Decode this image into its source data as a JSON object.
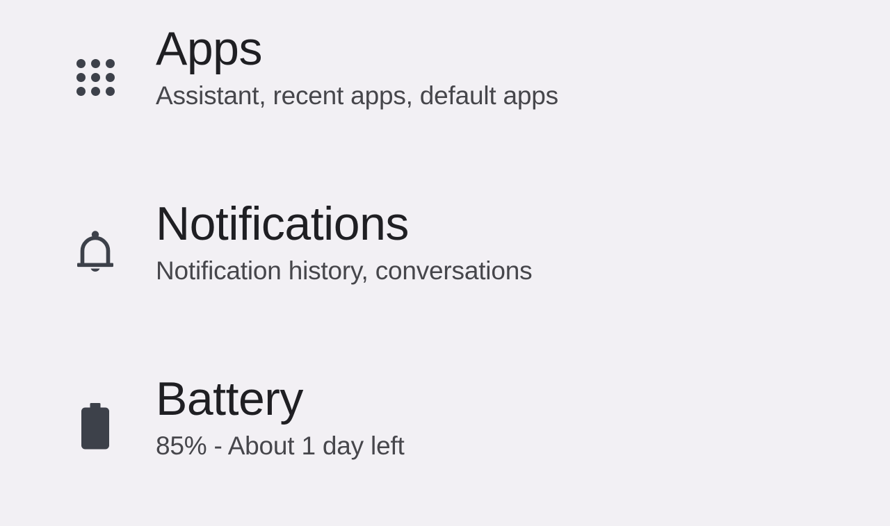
{
  "screen": {
    "background_color": "#f2f0f4",
    "title_color": "#1f1f23",
    "subtitle_color": "#46464b",
    "icon_color": "#3d414a"
  },
  "settings": {
    "rows": [
      {
        "id": "apps",
        "icon": "apps-grid-icon",
        "title": "Apps",
        "subtitle": "Assistant, recent apps, default apps"
      },
      {
        "id": "notifications",
        "icon": "bell-icon",
        "title": "Notifications",
        "subtitle": "Notification history, conversations"
      },
      {
        "id": "battery",
        "icon": "battery-icon",
        "title": "Battery",
        "subtitle": "85% - About 1 day left"
      }
    ]
  }
}
